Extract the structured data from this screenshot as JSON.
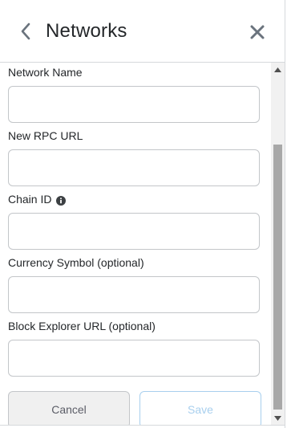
{
  "header": {
    "title": "Networks",
    "back_icon": "chevron-left-icon",
    "close_icon": "close-icon"
  },
  "form": {
    "fields": [
      {
        "label": "Network Name",
        "value": "",
        "placeholder": ""
      },
      {
        "label": "New RPC URL",
        "value": "",
        "placeholder": ""
      },
      {
        "label": "Chain ID",
        "value": "",
        "placeholder": "",
        "info_icon": "info-icon"
      },
      {
        "label": "Currency Symbol (optional)",
        "value": "",
        "placeholder": ""
      },
      {
        "label": "Block Explorer URL (optional)",
        "value": "",
        "placeholder": ""
      }
    ]
  },
  "actions": {
    "cancel_label": "Cancel",
    "save_label": "Save"
  },
  "colors": {
    "text": "#24272a",
    "border": "#c3c6c9",
    "save_disabled": "#a8cfee",
    "cancel_bg": "#f0f0f0"
  }
}
